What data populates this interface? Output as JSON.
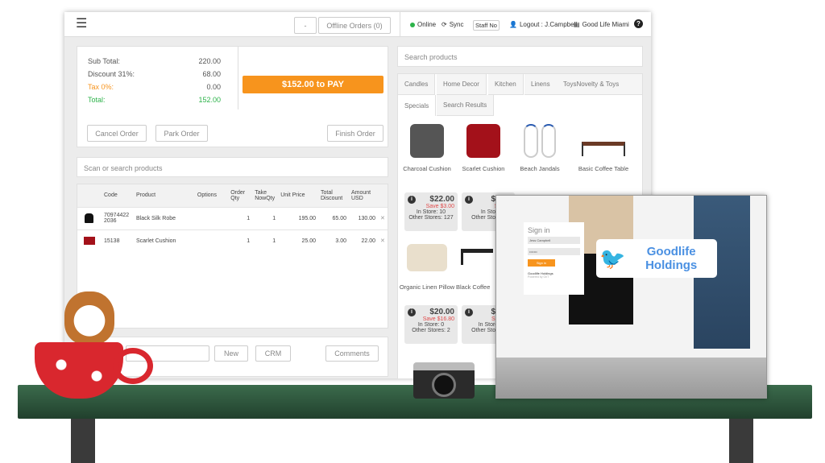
{
  "topbar": {
    "dash_label": "-",
    "offline_orders": "Offline Orders (0)",
    "online": "Online",
    "sync": "Sync",
    "staff": "Staff No",
    "logout": "Logout : J.Campbell",
    "store": "Good Life Miami",
    "help": "?"
  },
  "summary": {
    "subtotal_label": "Sub Total:",
    "subtotal": "220.00",
    "discount_label": "Discount 31%:",
    "discount": "68.00",
    "tax_label": "Tax 0%:",
    "tax": "0.00",
    "total_label": "Total:",
    "total": "152.00",
    "pay_label": "$152.00 to PAY",
    "cancel": "Cancel Order",
    "park": "Park Order",
    "finish": "Finish Order"
  },
  "scan_placeholder": "Scan or search products",
  "order_table": {
    "headers": [
      "",
      "Code",
      "Product",
      "Options",
      "Order Qty",
      "Take NowQty",
      "Unit Price",
      "Total Discount",
      "Amount USD",
      ""
    ],
    "rows": [
      {
        "code": "709744222036",
        "product": "Black Silk Robe",
        "options": "",
        "qty": "1",
        "take": "1",
        "price": "195.00",
        "discount": "65.00",
        "amount": "130.00"
      },
      {
        "code": "15138",
        "product": "Scarlet Cushion",
        "options": "",
        "qty": "1",
        "take": "1",
        "price": "25.00",
        "discount": "3.00",
        "amount": "22.00"
      }
    ]
  },
  "bottom": {
    "new": "New",
    "crm": "CRM",
    "comments": "Comments"
  },
  "search_products_placeholder": "Search products",
  "tabs": [
    "Candles",
    "Home Decor",
    "Kitchen",
    "Linens",
    "ToysNovelty & Toys",
    "Specials",
    "Search Results"
  ],
  "products": [
    {
      "name": "Charcoal Cushion"
    },
    {
      "name": "Scarlet Cushion"
    },
    {
      "name": "Beach Jandals"
    },
    {
      "name": "Basic Coffee Table"
    },
    {
      "name": "Organic Linen Pillow"
    },
    {
      "name": "Black Coffee"
    }
  ],
  "price_boxes": [
    {
      "price": "$22.00",
      "save": "Save $3.00",
      "in_store": "In Store: 10",
      "other": "Other Stores: 127"
    },
    {
      "price": "$2",
      "save": "Sa",
      "in_store": "In Sto",
      "other": "Other Stores:"
    },
    {
      "price": "$20.00",
      "save": "Save $16.80",
      "in_store": "In Store: 0",
      "other": "Other Stores: 2"
    },
    {
      "price": "$1",
      "save": "Save",
      "in_store": "In Store",
      "other": "Other Stores:"
    }
  ],
  "login": {
    "title": "Sign in",
    "user": "Jess Campbell",
    "password": "•••••••",
    "button": "Sign in",
    "company": "Goodlife Holdings",
    "powered": "Powered by OnT",
    "logo_text": "Goodlife Holdings"
  },
  "colors": {
    "orange": "#f7941d",
    "green": "#2db34a",
    "red": "#e04b4b",
    "desk": "#2f5a3f"
  }
}
